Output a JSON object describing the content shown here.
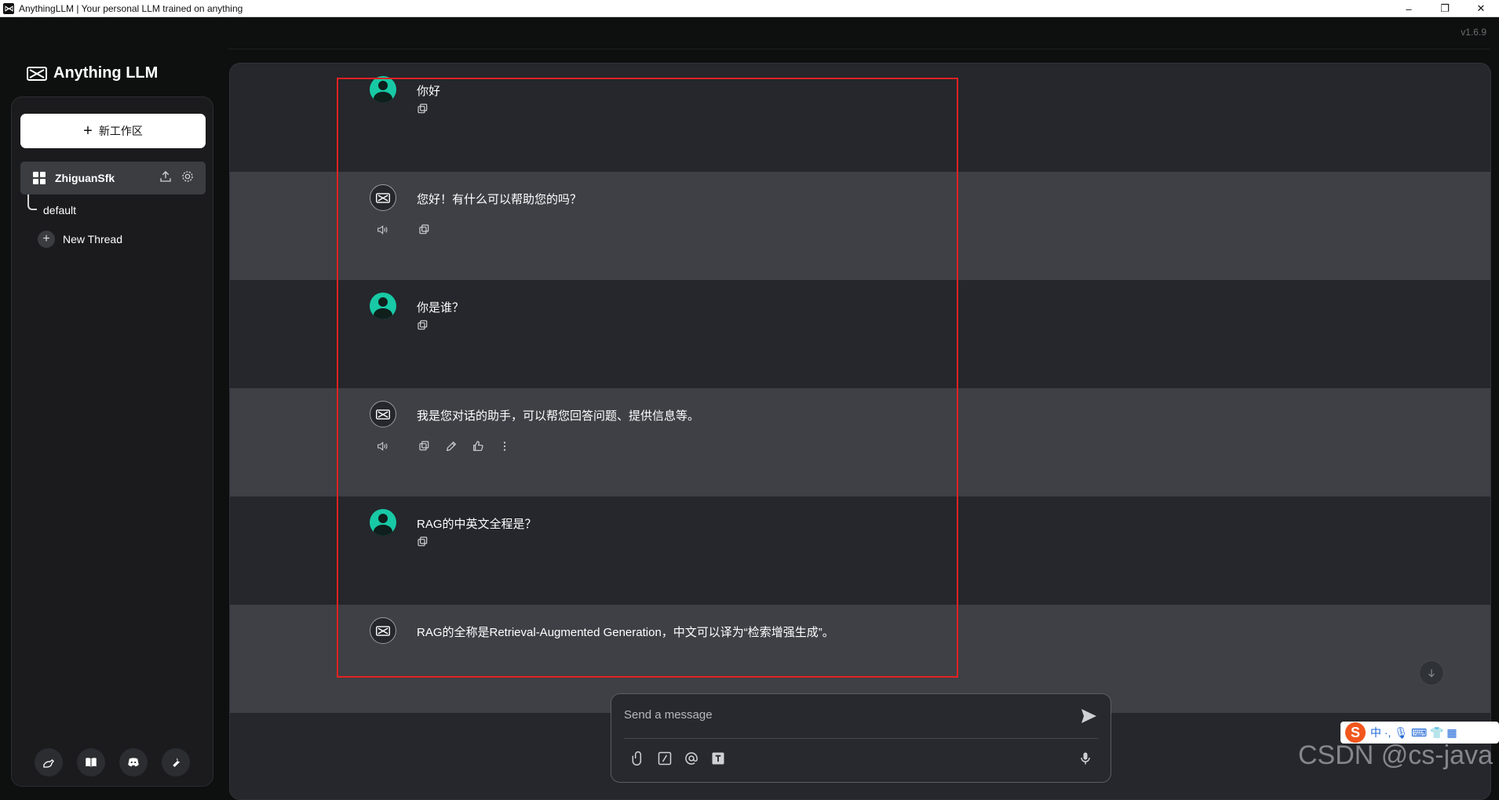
{
  "window": {
    "title": "AnythingLLM | Your personal LLM trained on anything",
    "minimize": "–",
    "maximize": "❐",
    "close": "✕"
  },
  "version": "v1.6.9",
  "brand": {
    "name": "Anything LLM",
    "icon": "anythingllm-logo-icon"
  },
  "sidebar": {
    "new_workspace_label": "新工作区",
    "workspace": {
      "name": "ZhiguanSfk",
      "icons": [
        "upload-icon",
        "gear-icon"
      ]
    },
    "threads": [
      {
        "label": "default"
      }
    ],
    "new_thread_label": "New Thread",
    "footer_icons": [
      "community-hub-icon",
      "docs-book-icon",
      "discord-icon",
      "settings-wrench-icon"
    ]
  },
  "chat": {
    "messages": [
      {
        "role": "user",
        "text": "你好"
      },
      {
        "role": "assistant",
        "text": "您好！有什么可以帮助您的吗？"
      },
      {
        "role": "user",
        "text": "你是谁？"
      },
      {
        "role": "assistant",
        "text": "我是您对话的助手，可以帮您回答问题、提供信息等。"
      },
      {
        "role": "user",
        "text": "RAG的中英文全程是？"
      },
      {
        "role": "assistant",
        "text": "RAG的全称是Retrieval-Augmented Generation，中文可以译为“检索增强生成”。"
      }
    ]
  },
  "composer": {
    "placeholder": "Send a message",
    "icons": [
      "paperclip-icon",
      "slash-command-icon",
      "at-mention-icon",
      "text-size-icon",
      "microphone-icon",
      "send-icon"
    ]
  },
  "ime": {
    "logo": "S",
    "items": "中 ·, 🎙 ⌨ 👕 ▦"
  },
  "watermark": "CSDN @cs-java",
  "colors": {
    "background": "#0e0f0f",
    "main_panel": "#25272c",
    "assistant_row": "#3e4046",
    "user_avatar": "#18c9a5",
    "highlight_box": "#e52222"
  }
}
